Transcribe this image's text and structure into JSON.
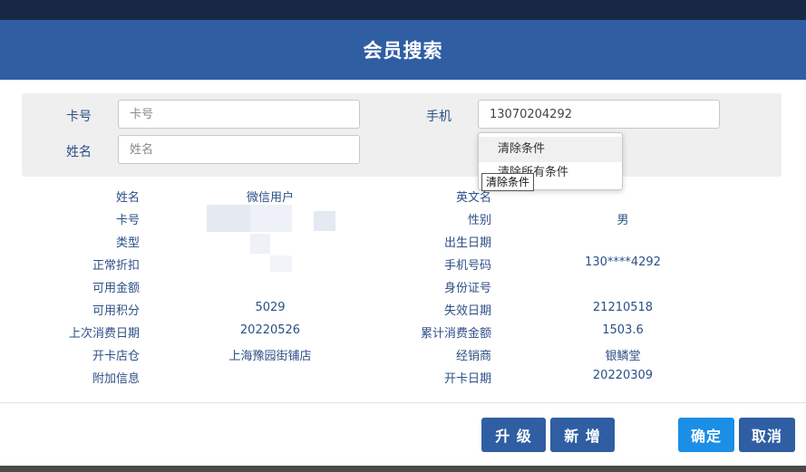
{
  "dialog": {
    "title": "会员搜索"
  },
  "search": {
    "card_label": "卡号",
    "card_placeholder": "卡号",
    "card_value": "",
    "phone_label": "手机",
    "phone_value": "13070204292",
    "name_label": "姓名",
    "name_placeholder": "姓名",
    "name_value": ""
  },
  "context_menu": {
    "items": [
      "清除条件",
      "清除所有条件"
    ]
  },
  "tooltip": "清除条件",
  "details": {
    "left": [
      {
        "label": "姓名",
        "value": "微信用户"
      },
      {
        "label": "卡号",
        "value": ""
      },
      {
        "label": "类型",
        "value": ""
      },
      {
        "label": "正常折扣",
        "value": ""
      },
      {
        "label": "可用金额",
        "value": ""
      },
      {
        "label": "可用积分",
        "value": "5029"
      },
      {
        "label": "上次消费日期",
        "value": "20220526"
      },
      {
        "label": "开卡店仓",
        "value": "上海豫园街铺店"
      },
      {
        "label": "附加信息",
        "value": ""
      }
    ],
    "right": [
      {
        "label": "英文名",
        "value": ""
      },
      {
        "label": "性别",
        "value": "男"
      },
      {
        "label": "出生日期",
        "value": ""
      },
      {
        "label": "手机号码",
        "value": "130****4292"
      },
      {
        "label": "身份证号",
        "value": ""
      },
      {
        "label": "失效日期",
        "value": "21210518"
      },
      {
        "label": "累计消费金额",
        "value": "1503.6"
      },
      {
        "label": "经销商",
        "value": "银鳞堂"
      },
      {
        "label": "开卡日期",
        "value": "20220309"
      }
    ]
  },
  "buttons": {
    "upgrade": "升 级",
    "add": "新 增",
    "confirm": "确定",
    "cancel": "取消"
  },
  "colors": {
    "header": "#2f5ea3",
    "button_dark": "#2f5ea3",
    "button_confirm": "#1b8ee6",
    "label_text": "#2c4f86"
  }
}
